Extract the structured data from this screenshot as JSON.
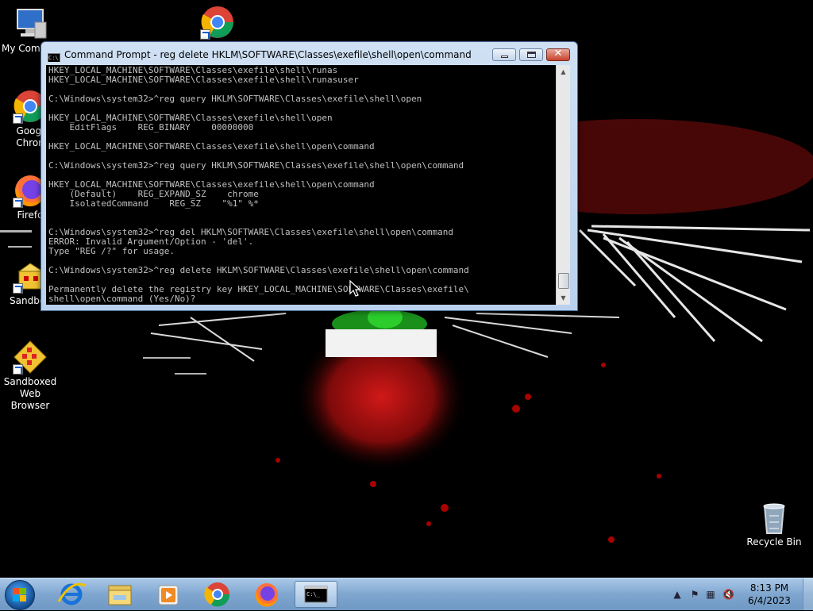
{
  "desktop": {
    "icons": [
      {
        "label": "My Comp",
        "icon": "computer-icon"
      },
      {
        "label": "",
        "icon": "chrome-icon"
      },
      {
        "label": "Googl\nChron",
        "icon": "chrome-icon"
      },
      {
        "label": "Firefo",
        "icon": "firefox-icon"
      },
      {
        "label": "Sandbox",
        "icon": "sandboxie-icon"
      },
      {
        "label": "Sandboxed\nWeb Browser",
        "icon": "sandboxed-browser-icon"
      },
      {
        "label": "Recycle Bin",
        "icon": "recycle-bin-icon"
      }
    ]
  },
  "cmd": {
    "title": "Command Prompt - reg  delete HKLM\\SOFTWARE\\Classes\\exefile\\shell\\open\\command",
    "lines": [
      "HKEY_LOCAL_MACHINE\\SOFTWARE\\Classes\\exefile\\shell\\runas",
      "HKEY_LOCAL_MACHINE\\SOFTWARE\\Classes\\exefile\\shell\\runasuser",
      "",
      "C:\\Windows\\system32>^reg query HKLM\\SOFTWARE\\Classes\\exefile\\shell\\open",
      "",
      "HKEY_LOCAL_MACHINE\\SOFTWARE\\Classes\\exefile\\shell\\open",
      "    EditFlags    REG_BINARY    00000000",
      "",
      "HKEY_LOCAL_MACHINE\\SOFTWARE\\Classes\\exefile\\shell\\open\\command",
      "",
      "C:\\Windows\\system32>^reg query HKLM\\SOFTWARE\\Classes\\exefile\\shell\\open\\command",
      "",
      "HKEY_LOCAL_MACHINE\\SOFTWARE\\Classes\\exefile\\shell\\open\\command",
      "    (Default)    REG_EXPAND_SZ    chrome",
      "    IsolatedCommand    REG_SZ    \"%1\" %*",
      "",
      "",
      "C:\\Windows\\system32>^reg del HKLM\\SOFTWARE\\Classes\\exefile\\shell\\open\\command",
      "ERROR: Invalid Argument/Option - 'del'.",
      "Type \"REG /?\" for usage.",
      "",
      "C:\\Windows\\system32>^reg delete HKLM\\SOFTWARE\\Classes\\exefile\\shell\\open\\command",
      "",
      "Permanently delete the registry key HKEY_LOCAL_MACHINE\\SOFTWARE\\Classes\\exefile\\",
      "shell\\open\\command (Yes/No)?"
    ],
    "buttons": {
      "minimize": "minimize-button",
      "maximize": "maximize-button",
      "close": "close-button"
    }
  },
  "taskbar": {
    "pinned": [
      "internet-explorer-icon",
      "file-explorer-icon",
      "media-player-icon",
      "chrome-icon",
      "firefox-icon",
      "command-prompt-icon"
    ],
    "clock": {
      "time": "8:13 PM",
      "date": "6/4/2023"
    },
    "tray": [
      "show-hidden-icons-arrow",
      "action-center-flag-icon",
      "network-icon",
      "volume-muted-icon"
    ]
  },
  "colors": {
    "console_bg": "#000000",
    "console_fg": "#c0c0c0",
    "taskbar": "#7fa6cf"
  }
}
